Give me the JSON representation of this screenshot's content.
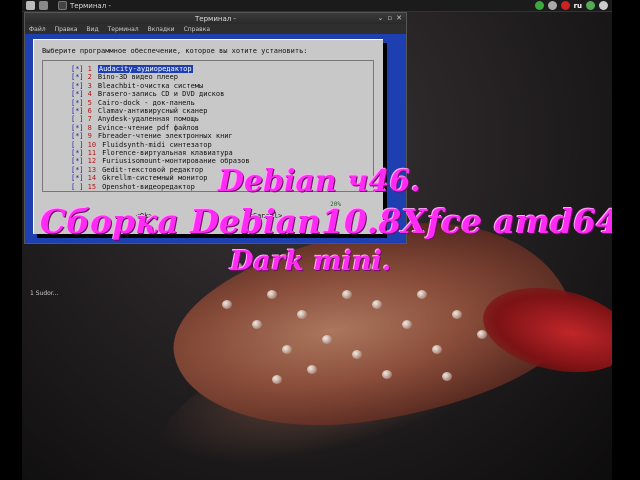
{
  "top_panel": {
    "task_label": "Терминал -",
    "keyboard_layout": "ru",
    "colors": {
      "panel_bg": "#1b1b1b"
    }
  },
  "desktop_icons": [
    {
      "label": "1 Sudor..."
    }
  ],
  "terminal": {
    "title": "Терминал -",
    "controls": [
      "⌄",
      "▫",
      "✕"
    ],
    "menu": [
      "Файл",
      "Правка",
      "Вид",
      "Терминал",
      "Вкладки",
      "Справка"
    ]
  },
  "dialog": {
    "prompt": "Выберите программное обеспечение, которое вы хотите установить:",
    "items": [
      {
        "mark": "[*]",
        "num": "1",
        "label": "Audacity-аудиоредактор",
        "selected": true
      },
      {
        "mark": "[*]",
        "num": "2",
        "label": "Bino-3D видео плеер"
      },
      {
        "mark": "[*]",
        "num": "3",
        "label": "Bleachbit-очистка системы"
      },
      {
        "mark": "[*]",
        "num": "4",
        "label": "Brasero-запись CD и DVD дисков"
      },
      {
        "mark": "[*]",
        "num": "5",
        "label": "Cairo-dock - док-панель"
      },
      {
        "mark": "[*]",
        "num": "6",
        "label": "Clamav-антивирусный сканер"
      },
      {
        "mark": "[ ]",
        "num": "7",
        "label": "Anydesk-удаленная помощь"
      },
      {
        "mark": "[*]",
        "num": "8",
        "label": "Evince-чтение pdf файлов"
      },
      {
        "mark": "[*]",
        "num": "9",
        "label": "Fbreader-чтение электронных книг"
      },
      {
        "mark": "[ ]",
        "num": "10",
        "label": "Fluidsynth-midi синтезатор"
      },
      {
        "mark": "[*]",
        "num": "11",
        "label": "Florence-виртуальная клавиатура"
      },
      {
        "mark": "[*]",
        "num": "12",
        "label": "Furiusisomount-монтирование образов"
      },
      {
        "mark": "[*]",
        "num": "13",
        "label": "Gedit-текстовой редактор"
      },
      {
        "mark": "[*]",
        "num": "14",
        "label": "Gkrellm-системный монитор"
      },
      {
        "mark": "[ ]",
        "num": "15",
        "label": "Openshot-видеоредактор"
      }
    ],
    "progress": "20%",
    "buttons": {
      "ok": "<Ok>",
      "cancel": "<Cancel>"
    }
  },
  "overlay": {
    "line1": "Debian ч46.",
    "line2": "Сборка Debian10.8Xfce amd64",
    "line3": "Dark mini."
  },
  "colors": {
    "dialog_bg": "#c8c8c8",
    "terminal_blue": "#1e3fb0",
    "overlay_text": "#ff2bf5"
  }
}
